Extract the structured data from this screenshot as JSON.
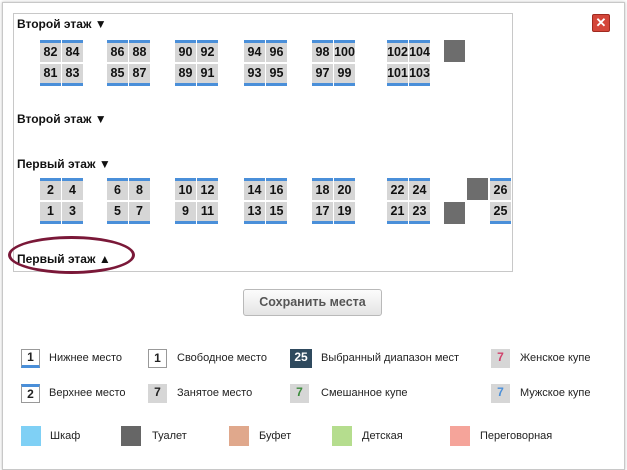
{
  "close_icon": "close-icon",
  "floors": {
    "second_open": "Второй этаж ▼",
    "second_collapsed": "Второй этаж ▼",
    "first_open": "Первый этаж ▼",
    "first_collapsed": "Первый этаж ▲"
  },
  "second_floor_coupes": [
    {
      "upper": [
        "82",
        "84"
      ],
      "lower": [
        "81",
        "83"
      ]
    },
    {
      "upper": [
        "86",
        "88"
      ],
      "lower": [
        "85",
        "87"
      ]
    },
    {
      "upper": [
        "90",
        "92"
      ],
      "lower": [
        "89",
        "91"
      ]
    },
    {
      "upper": [
        "94",
        "96"
      ],
      "lower": [
        "93",
        "95"
      ]
    },
    {
      "upper": [
        "98",
        "100"
      ],
      "lower": [
        "97",
        "99"
      ]
    },
    {
      "upper": [
        "102",
        "104"
      ],
      "lower": [
        "101",
        "103"
      ]
    }
  ],
  "first_floor_coupes": [
    {
      "upper": [
        "2",
        "4"
      ],
      "lower": [
        "1",
        "3"
      ]
    },
    {
      "upper": [
        "6",
        "8"
      ],
      "lower": [
        "5",
        "7"
      ]
    },
    {
      "upper": [
        "10",
        "12"
      ],
      "lower": [
        "9",
        "11"
      ]
    },
    {
      "upper": [
        "14",
        "16"
      ],
      "lower": [
        "13",
        "15"
      ]
    },
    {
      "upper": [
        "18",
        "20"
      ],
      "lower": [
        "17",
        "19"
      ]
    },
    {
      "upper": [
        "22",
        "24"
      ],
      "lower": [
        "21",
        "23"
      ]
    }
  ],
  "side_seats": {
    "upper": "26",
    "lower": "25"
  },
  "save_button": "Сохранить места",
  "legend": {
    "lower_seat": {
      "box": "1",
      "label": "Нижнее место"
    },
    "free_seat": {
      "box": "1",
      "label": "Свободное место"
    },
    "selected_range": {
      "box": "25",
      "label": "Выбранный диапазон мест"
    },
    "female_coupe": {
      "box": "7",
      "label": "Женское купе"
    },
    "upper_seat": {
      "box": "2",
      "label": "Верхнее место"
    },
    "taken_seat": {
      "box": "7",
      "label": "Занятое место"
    },
    "mixed_coupe": {
      "box": "7",
      "label": "Смешанное купе"
    },
    "male_coupe": {
      "box": "7",
      "label": "Мужское купе"
    },
    "wardrobe": {
      "label": "Шкаф",
      "color": "#7fd0f5"
    },
    "toilet": {
      "label": "Туалет",
      "color": "#666666"
    },
    "buffet": {
      "label": "Буфет",
      "color": "#e0a88c"
    },
    "kids": {
      "label": "Детская",
      "color": "#b5dd8e"
    },
    "meeting": {
      "label": "Переговорная",
      "color": "#f5a49a"
    }
  },
  "colors": {
    "seat_stripe": "#4a8fd9",
    "seat_bg": "#d6d6d6",
    "selected_bg": "#2f4a5e",
    "female_digit": "#d0406a",
    "mixed_digit": "#3a8a3a",
    "male_digit": "#4a8fd9",
    "highlight_oval": "#7a1838"
  }
}
